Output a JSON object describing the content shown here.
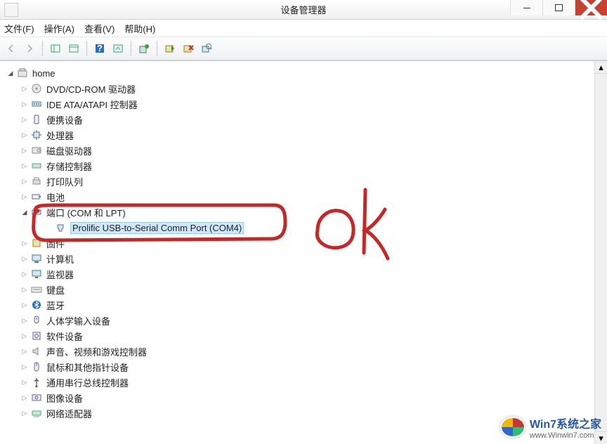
{
  "window": {
    "title": "设备管理器"
  },
  "menus": {
    "file": "文件(F)",
    "action": "操作(A)",
    "view": "查看(V)",
    "help": "帮助(H)"
  },
  "tree": {
    "root": "home",
    "items": [
      {
        "label": "DVD/CD-ROM 驱动器",
        "icon": "dvd"
      },
      {
        "label": "IDE ATA/ATAPI 控制器",
        "icon": "ide"
      },
      {
        "label": "便携设备",
        "icon": "portable"
      },
      {
        "label": "处理器",
        "icon": "cpu"
      },
      {
        "label": "磁盘驱动器",
        "icon": "disk"
      },
      {
        "label": "存储控制器",
        "icon": "storage"
      },
      {
        "label": "打印队列",
        "icon": "printer"
      },
      {
        "label": "电池",
        "icon": "battery"
      },
      {
        "label": "端口 (COM 和 LPT)",
        "icon": "port",
        "expanded": true,
        "children": [
          {
            "label": "Prolific USB-to-Serial Comm Port (COM4)",
            "icon": "port-leaf",
            "selected": true
          }
        ]
      },
      {
        "label": "固件",
        "icon": "firmware"
      },
      {
        "label": "计算机",
        "icon": "computer"
      },
      {
        "label": "监视器",
        "icon": "monitor"
      },
      {
        "label": "键盘",
        "icon": "keyboard"
      },
      {
        "label": "蓝牙",
        "icon": "bluetooth"
      },
      {
        "label": "人体学输入设备",
        "icon": "hid"
      },
      {
        "label": "软件设备",
        "icon": "software"
      },
      {
        "label": "声音、视频和游戏控制器",
        "icon": "sound"
      },
      {
        "label": "鼠标和其他指针设备",
        "icon": "mouse"
      },
      {
        "label": "通用串行总线控制器",
        "icon": "usb"
      },
      {
        "label": "图像设备",
        "icon": "image"
      },
      {
        "label": "网络适配器",
        "icon": "network"
      }
    ]
  },
  "annotation": {
    "text": "ok",
    "color": "#c62828"
  },
  "watermark": {
    "line1": "Win7系统之家",
    "line2": "www.Winwin7.com"
  }
}
